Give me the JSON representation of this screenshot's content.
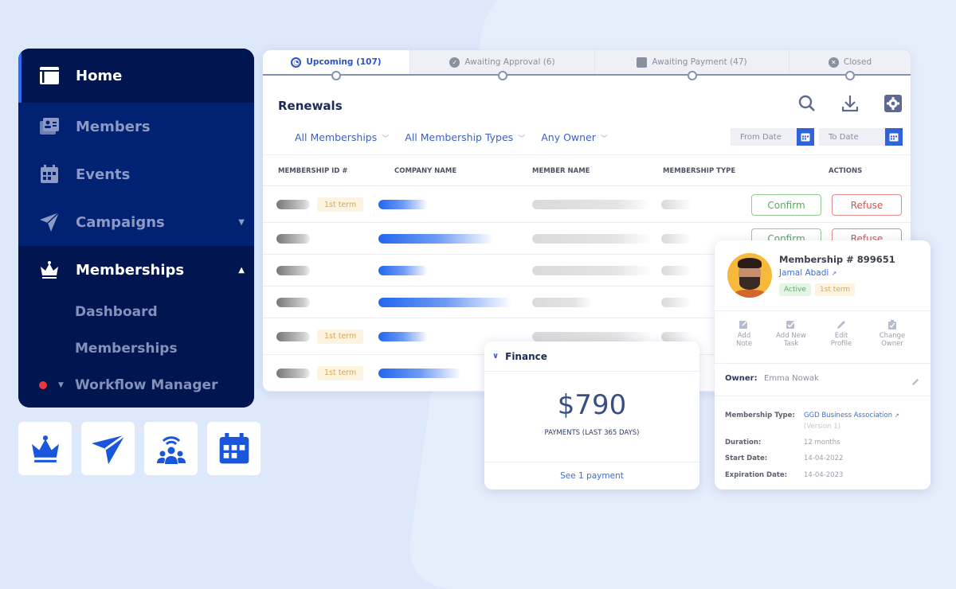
{
  "sidebar": {
    "items": [
      {
        "label": "Home",
        "icon": "home-layout-icon",
        "state": "active"
      },
      {
        "label": "Members",
        "icon": "member-card-icon"
      },
      {
        "label": "Events",
        "icon": "calendar-icon"
      },
      {
        "label": "Campaigns",
        "icon": "paper-plane-icon",
        "caret": "down"
      },
      {
        "label": "Memberships",
        "icon": "crown-icon",
        "caret": "up",
        "state": "open"
      }
    ],
    "sub_items": [
      {
        "label": "Dashboard"
      },
      {
        "label": "Memberships"
      },
      {
        "label": "Workflow Manager",
        "indicator": "red-dot"
      }
    ]
  },
  "quick_icons": [
    "crown-icon",
    "paper-plane-icon",
    "community-broadcast-icon",
    "calendar-icon"
  ],
  "renewals": {
    "tabs": [
      {
        "label": "Upcoming (107)",
        "icon": "progress-icon",
        "active": true
      },
      {
        "label": "Awaiting Approval (6)",
        "icon": "check-circle-icon"
      },
      {
        "label": "Awaiting Payment (47)",
        "icon": "wallet-icon"
      },
      {
        "label": "Closed",
        "icon": "close-circle-icon"
      }
    ],
    "title": "Renewals",
    "filters": [
      "All Memberships",
      "All Membership Types",
      "Any Owner"
    ],
    "from_date_placeholder": "From Date",
    "to_date_placeholder": "To Date",
    "columns": [
      "MEMBERSHIP ID #",
      "COMPANY NAME",
      "MEMBER NAME",
      "MEMBERSHIP TYPE",
      "ACTIONS"
    ],
    "term_badge": "1st term",
    "confirm_label": "Confirm",
    "refuse_label": "Refuse",
    "rows": [
      {
        "term": true
      },
      {
        "term": false
      },
      {
        "term": false
      },
      {
        "term": false
      },
      {
        "term": true
      },
      {
        "term": true
      }
    ]
  },
  "finance": {
    "title": "Finance",
    "amount": "$790",
    "amount_label": "PAYMENTS (LAST 365 DAYS)",
    "footer_link": "See 1 payment"
  },
  "member_card": {
    "membership_number": "Membership # 899651",
    "member_name": "Jamal Abadi",
    "status": "Active",
    "term": "1st term",
    "actions": [
      {
        "label_line1": "Add",
        "label_line2": "Note",
        "icon": "note-edit-icon"
      },
      {
        "label_line1": "Add New",
        "label_line2": "Task",
        "icon": "task-check-icon"
      },
      {
        "label_line1": "Edit",
        "label_line2": "Profile",
        "icon": "pencil-icon"
      },
      {
        "label_line1": "Change",
        "label_line2": "Owner",
        "icon": "clipboard-icon"
      }
    ],
    "owner_label": "Owner:",
    "owner_value": "Emma Nowak",
    "details": [
      {
        "label": "Membership Type:",
        "value": "GGD Business Association",
        "sub": "(Version 1)"
      },
      {
        "label": "Duration:",
        "value": "12 months"
      },
      {
        "label": "Start Date:",
        "value": "14-04-2022"
      },
      {
        "label": "Expiration Date:",
        "value": "14-04-2023"
      }
    ]
  }
}
